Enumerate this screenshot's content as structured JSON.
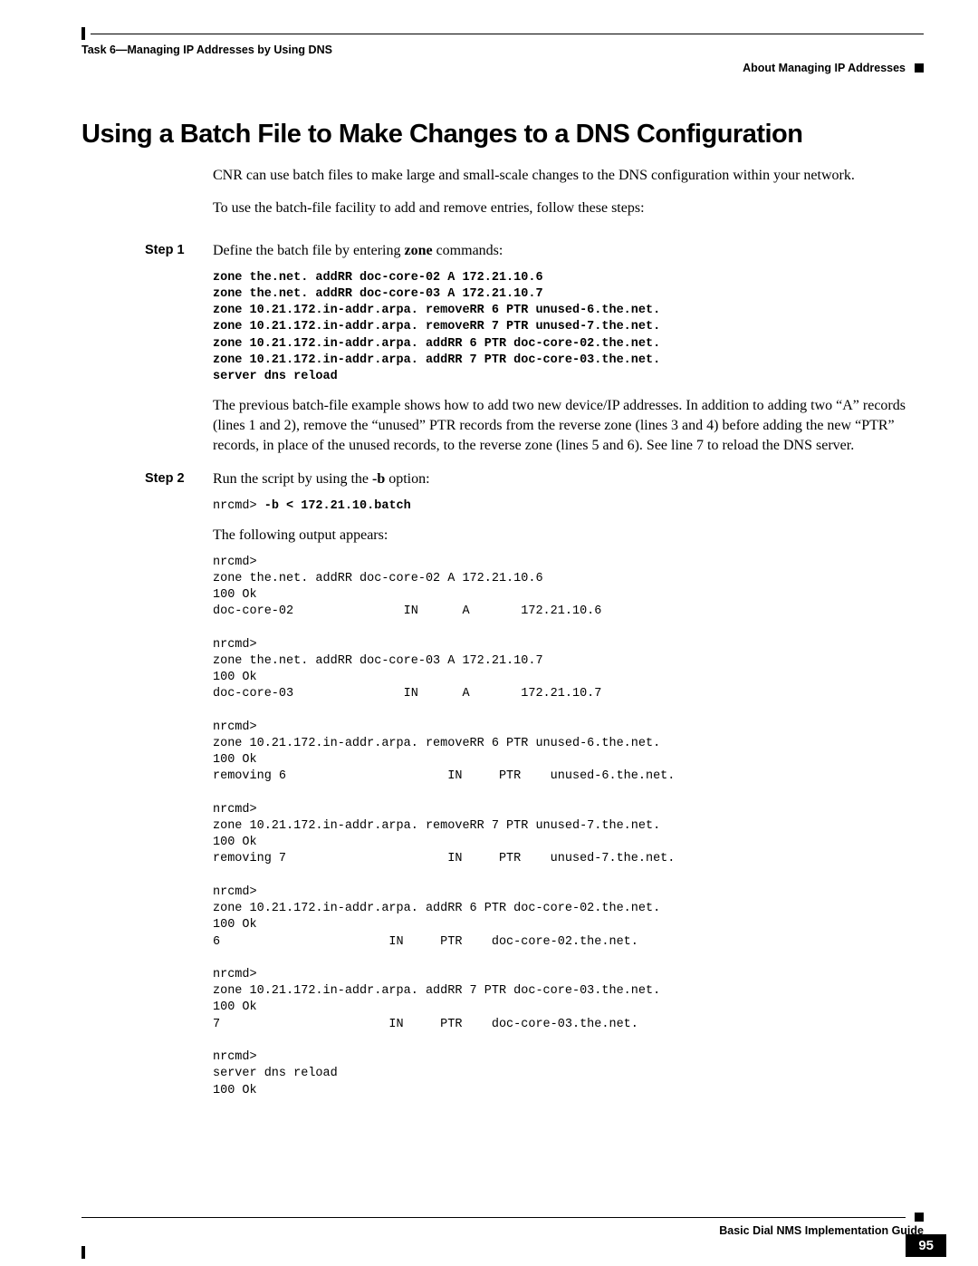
{
  "header": {
    "chapter": "Task 6—Managing IP Addresses by Using DNS",
    "section": "About Managing IP Addresses"
  },
  "title": "Using a Batch File to Make Changes to a DNS Configuration",
  "intro_p1": "CNR can use batch files to make large and small-scale changes to the DNS configuration within your network.",
  "intro_p2": "To use the batch-file facility to add and remove entries, follow these steps:",
  "step1": {
    "label": "Step 1",
    "lead_a": "Define the batch file by entering ",
    "lead_bold": "zone",
    "lead_b": " commands:",
    "code": "zone the.net. addRR doc-core-02 A 172.21.10.6\nzone the.net. addRR doc-core-03 A 172.21.10.7\nzone 10.21.172.in-addr.arpa. removeRR 6 PTR unused-6.the.net.\nzone 10.21.172.in-addr.arpa. removeRR 7 PTR unused-7.the.net.\nzone 10.21.172.in-addr.arpa. addRR 6 PTR doc-core-02.the.net.\nzone 10.21.172.in-addr.arpa. addRR 7 PTR doc-core-03.the.net.\nserver dns reload",
    "explain": "The previous batch-file example shows how to add two new device/IP addresses. In addition to adding two “A” records (lines 1 and 2), remove the “unused” PTR records from the reverse zone (lines 3 and 4) before adding the new “PTR” records, in place of the unused records, to the reverse zone (lines 5 and 6). See line 7 to reload the DNS server."
  },
  "step2": {
    "label": "Step 2",
    "lead_a": "Run the script by using the ",
    "lead_bold": "-b",
    "lead_b": " option:",
    "cmd_prefix": "nrcmd> ",
    "cmd_bold": "-b < 172.21.10.batch",
    "outro": "The following output appears:",
    "output": "nrcmd>\nzone the.net. addRR doc-core-02 A 172.21.10.6\n100 Ok\ndoc-core-02               IN      A       172.21.10.6\n\nnrcmd>\nzone the.net. addRR doc-core-03 A 172.21.10.7\n100 Ok\ndoc-core-03               IN      A       172.21.10.7\n\nnrcmd>\nzone 10.21.172.in-addr.arpa. removeRR 6 PTR unused-6.the.net.\n100 Ok\nremoving 6                      IN     PTR    unused-6.the.net.\n\nnrcmd>\nzone 10.21.172.in-addr.arpa. removeRR 7 PTR unused-7.the.net.\n100 Ok\nremoving 7                      IN     PTR    unused-7.the.net.\n\nnrcmd>\nzone 10.21.172.in-addr.arpa. addRR 6 PTR doc-core-02.the.net.\n100 Ok\n6                       IN     PTR    doc-core-02.the.net.\n\nnrcmd>\nzone 10.21.172.in-addr.arpa. addRR 7 PTR doc-core-03.the.net.\n100 Ok\n7                       IN     PTR    doc-core-03.the.net.\n\nnrcmd>\nserver dns reload\n100 Ok"
  },
  "footer": {
    "guide": "Basic Dial NMS Implementation Guide",
    "page": "95"
  }
}
